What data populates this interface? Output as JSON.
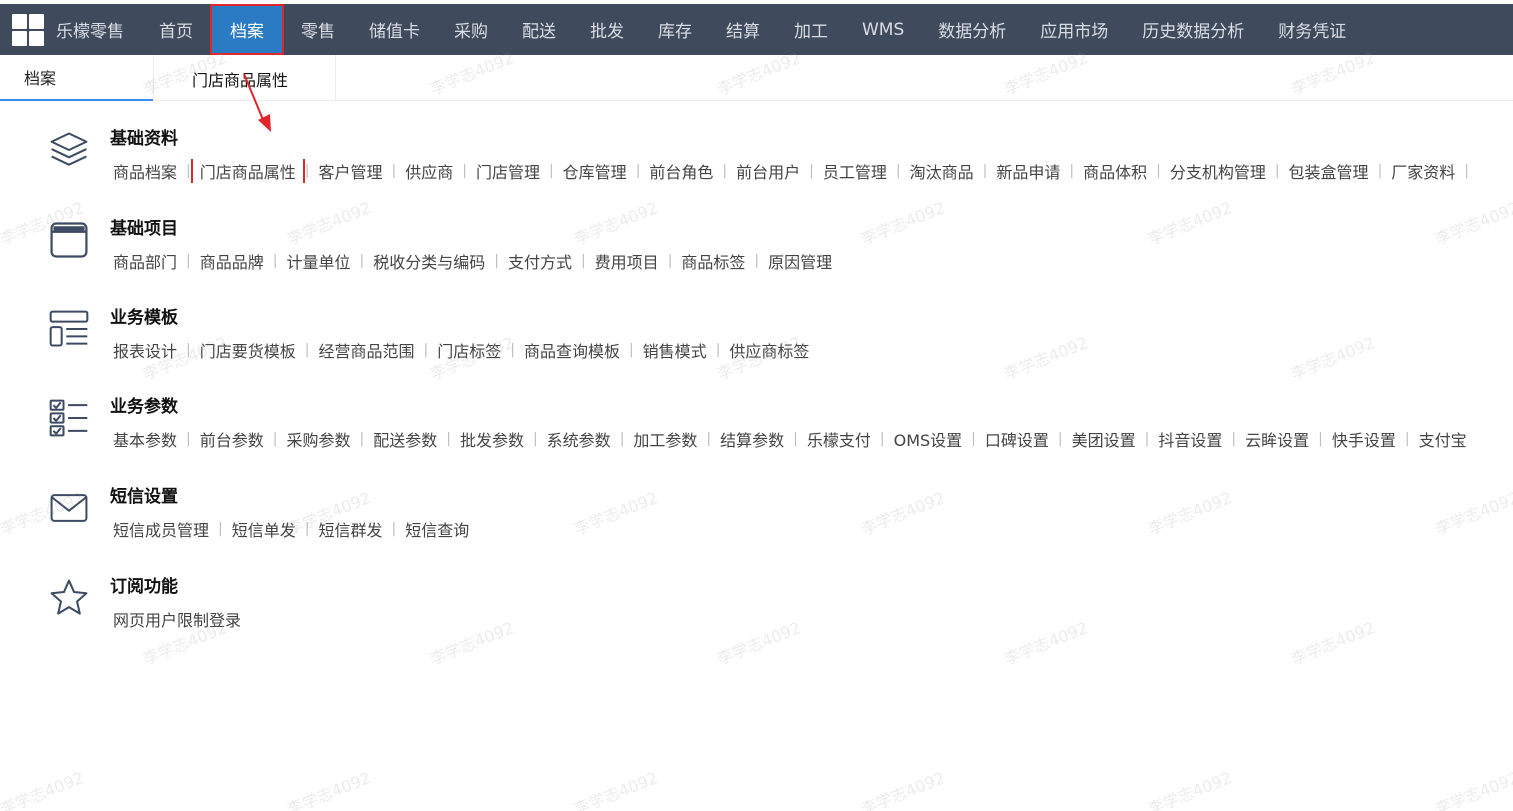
{
  "topnav": {
    "app_title": "乐檬零售",
    "items": [
      "首页",
      "档案",
      "零售",
      "储值卡",
      "采购",
      "配送",
      "批发",
      "库存",
      "结算",
      "加工",
      "WMS",
      "数据分析",
      "应用市场",
      "历史数据分析",
      "财务凭证"
    ],
    "active": "档案"
  },
  "tabs": {
    "main": "档案",
    "second": "门店商品属性"
  },
  "sections": [
    {
      "title": "基础资料",
      "icon": "layers-icon",
      "links": [
        "商品档案",
        "门店商品属性",
        "客户管理",
        "供应商",
        "门店管理",
        "仓库管理",
        "前台角色",
        "前台用户",
        "员工管理",
        "淘汰商品",
        "新品申请",
        "商品体积",
        "分支机构管理",
        "包装盒管理",
        "厂家资料"
      ]
    },
    {
      "title": "基础项目",
      "icon": "window-icon",
      "links": [
        "商品部门",
        "商品品牌",
        "计量单位",
        "税收分类与编码",
        "支付方式",
        "费用项目",
        "商品标签",
        "原因管理"
      ]
    },
    {
      "title": "业务模板",
      "icon": "template-icon",
      "links": [
        "报表设计",
        "门店要货模板",
        "经营商品范围",
        "门店标签",
        "商品查询模板",
        "销售模式",
        "供应商标签"
      ]
    },
    {
      "title": "业务参数",
      "icon": "checklist-icon",
      "links": [
        "基本参数",
        "前台参数",
        "采购参数",
        "配送参数",
        "批发参数",
        "系统参数",
        "加工参数",
        "结算参数",
        "乐檬支付",
        "OMS设置",
        "口碑设置",
        "美团设置",
        "抖音设置",
        "云眸设置",
        "快手设置",
        "支付宝"
      ]
    },
    {
      "title": "短信设置",
      "icon": "mail-icon",
      "links": [
        "短信成员管理",
        "短信单发",
        "短信群发",
        "短信查询"
      ]
    },
    {
      "title": "订阅功能",
      "icon": "star-icon",
      "links": [
        "网页用户限制登录"
      ]
    }
  ],
  "highlighted_link": "门店商品属性",
  "watermark": "李学志4092",
  "colors": {
    "topbar": "#3f4a5c",
    "active_nav": "#2a7bc4",
    "highlight_border": "#e0262b",
    "tab_underline": "#3a8ee6"
  }
}
